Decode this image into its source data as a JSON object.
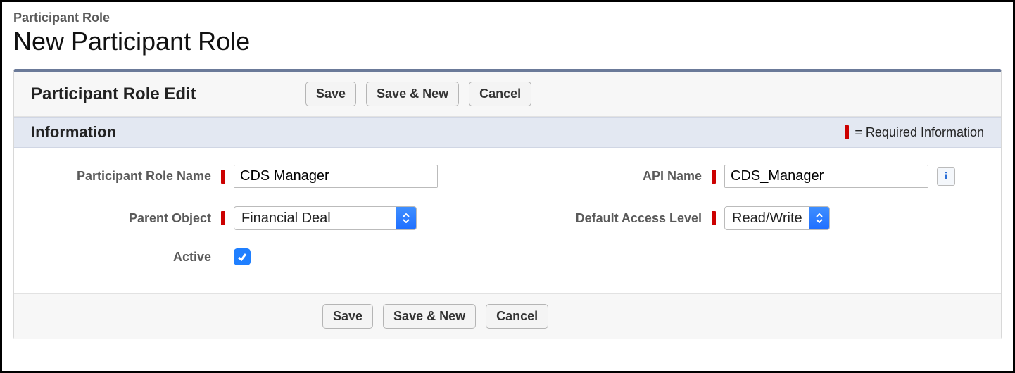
{
  "header": {
    "breadcrumb": "Participant Role",
    "title": "New Participant Role"
  },
  "panel": {
    "edit_title": "Participant Role Edit",
    "save_label": "Save",
    "save_new_label": "Save & New",
    "cancel_label": "Cancel"
  },
  "section": {
    "title": "Information",
    "required_legend": "= Required Information"
  },
  "fields": {
    "role_name": {
      "label": "Participant Role Name",
      "value": "CDS Manager",
      "required": true
    },
    "api_name": {
      "label": "API Name",
      "value": "CDS_Manager",
      "required": true
    },
    "parent_object": {
      "label": "Parent Object",
      "value": "Financial Deal",
      "required": true
    },
    "default_access": {
      "label": "Default Access Level",
      "value": "Read/Write",
      "required": true
    },
    "active": {
      "label": "Active",
      "checked": true
    }
  },
  "icons": {
    "info": "i"
  },
  "colors": {
    "required": "#c00",
    "accent": "#1f7fff"
  }
}
